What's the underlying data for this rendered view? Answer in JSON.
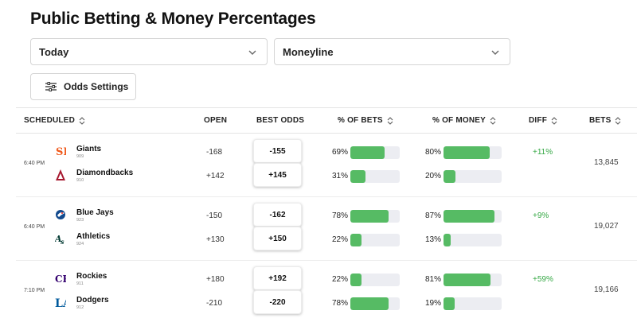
{
  "page_title": "Public Betting & Money Percentages",
  "filters": {
    "date": "Today",
    "market": "Moneyline",
    "odds_settings_label": "Odds Settings"
  },
  "columns": {
    "scheduled": "SCHEDULED",
    "open": "OPEN",
    "best_odds": "BEST ODDS",
    "pct_bets": "% OF BETS",
    "pct_money": "% OF MONEY",
    "diff": "DIFF",
    "bets": "BETS"
  },
  "colors": {
    "bar_fill": "#56bb64",
    "bar_track": "#ecedf2",
    "diff_text": "#35a845"
  },
  "games": [
    {
      "time": "6:40 PM",
      "diff": "+11%",
      "bets": "13,845",
      "teams": [
        {
          "name": "Giants",
          "id": "909",
          "icon": "giants-logo-icon",
          "open": "-168",
          "best": "-155",
          "bets_pct": "69%",
          "bets_val": 69,
          "money_pct": "80%",
          "money_val": 80
        },
        {
          "name": "Diamondbacks",
          "id": "910",
          "icon": "diamondbacks-logo-icon",
          "open": "+142",
          "best": "+145",
          "bets_pct": "31%",
          "bets_val": 31,
          "money_pct": "20%",
          "money_val": 20
        }
      ]
    },
    {
      "time": "6:40 PM",
      "diff": "+9%",
      "bets": "19,027",
      "teams": [
        {
          "name": "Blue Jays",
          "id": "923",
          "icon": "blue-jays-logo-icon",
          "open": "-150",
          "best": "-162",
          "bets_pct": "78%",
          "bets_val": 78,
          "money_pct": "87%",
          "money_val": 87
        },
        {
          "name": "Athletics",
          "id": "924",
          "icon": "athletics-logo-icon",
          "open": "+130",
          "best": "+150",
          "bets_pct": "22%",
          "bets_val": 22,
          "money_pct": "13%",
          "money_val": 13
        }
      ]
    },
    {
      "time": "7:10 PM",
      "diff": "+59%",
      "bets": "19,166",
      "teams": [
        {
          "name": "Rockies",
          "id": "911",
          "icon": "rockies-logo-icon",
          "open": "+180",
          "best": "+192",
          "bets_pct": "22%",
          "bets_val": 22,
          "money_pct": "81%",
          "money_val": 81
        },
        {
          "name": "Dodgers",
          "id": "912",
          "icon": "dodgers-logo-icon",
          "open": "-210",
          "best": "-220",
          "bets_pct": "78%",
          "bets_val": 78,
          "money_pct": "19%",
          "money_val": 19
        }
      ]
    }
  ]
}
